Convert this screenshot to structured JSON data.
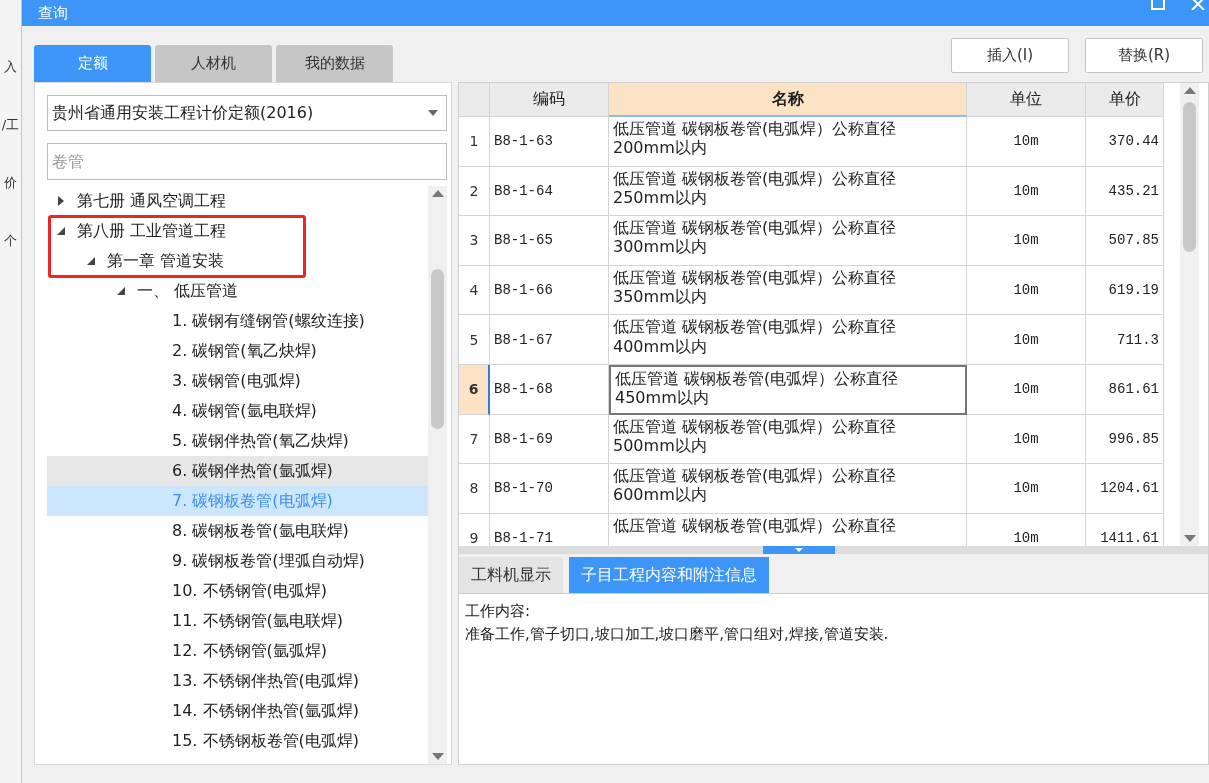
{
  "background_app": {
    "fragments": [
      "入",
      "/工",
      "价",
      "个"
    ]
  },
  "window": {
    "title": "查询"
  },
  "tabs": [
    {
      "label": "定额",
      "selected": true
    },
    {
      "label": "人材机",
      "selected": false
    },
    {
      "label": "我的数据",
      "selected": false
    }
  ],
  "actions": [
    "插入(I)",
    "替换(R)"
  ],
  "quota_book": {
    "value": "贵州省通用安装工程计价定额(2016)"
  },
  "search": {
    "placeholder": "卷管"
  },
  "tree": [
    {
      "label": "第七册 通风空调工程",
      "expanded": false,
      "selected": false
    },
    {
      "label": "第八册 工业管道工程",
      "expanded": true,
      "selected": false,
      "children": [
        {
          "label": "第一章 管道安装",
          "expanded": true,
          "selected": false,
          "children": [
            {
              "label": "一、  低压管道",
              "expanded": true,
              "selected": false,
              "children": [
                {
                  "label": "1. 碳钢有缝钢管(螺纹连接)",
                  "selected": false,
                  "hovered": false
                },
                {
                  "label": "2. 碳钢管(氧乙炔焊)",
                  "selected": false,
                  "hovered": false
                },
                {
                  "label": "3. 碳钢管(电弧焊)",
                  "selected": false,
                  "hovered": false
                },
                {
                  "label": "4. 碳钢管(氩电联焊)",
                  "selected": false,
                  "hovered": false
                },
                {
                  "label": "5. 碳钢伴热管(氧乙炔焊)",
                  "selected": false,
                  "hovered": false
                },
                {
                  "label": "6. 碳钢伴热管(氩弧焊)",
                  "selected": false,
                  "hovered": true
                },
                {
                  "label": "7. 碳钢板卷管(电弧焊)",
                  "selected": true,
                  "hovered": false
                },
                {
                  "label": "8. 碳钢板卷管(氩电联焊)",
                  "selected": false,
                  "hovered": false
                },
                {
                  "label": "9. 碳钢板卷管(埋弧自动焊)",
                  "selected": false,
                  "hovered": false
                },
                {
                  "label": "10. 不锈钢管(电弧焊)",
                  "selected": false,
                  "hovered": false
                },
                {
                  "label": "11. 不锈钢管(氩电联焊)",
                  "selected": false,
                  "hovered": false
                },
                {
                  "label": "12. 不锈钢管(氩弧焊)",
                  "selected": false,
                  "hovered": false
                },
                {
                  "label": "13. 不锈钢伴热管(电弧焊)",
                  "selected": false,
                  "hovered": false
                },
                {
                  "label": "14. 不锈钢伴热管(氩弧焊)",
                  "selected": false,
                  "hovered": false
                },
                {
                  "label": "15. 不锈钢板卷管(电弧焊)",
                  "selected": false,
                  "hovered": false
                }
              ]
            }
          ]
        }
      ]
    }
  ],
  "table": {
    "columns": [
      {
        "label": "编码",
        "selected": false
      },
      {
        "label": "名称",
        "selected": true
      },
      {
        "label": "单位",
        "selected": false
      },
      {
        "label": "单价",
        "selected": false
      }
    ],
    "rows": [
      {
        "index": "1",
        "code": "B8-1-63",
        "name": "低压管道 碳钢板卷管(电弧焊）公称直径200mm以内",
        "unit": "10m",
        "price": "370.44",
        "selected": false
      },
      {
        "index": "2",
        "code": "B8-1-64",
        "name": "低压管道 碳钢板卷管(电弧焊）公称直径250mm以内",
        "unit": "10m",
        "price": "435.21",
        "selected": false
      },
      {
        "index": "3",
        "code": "B8-1-65",
        "name": "低压管道 碳钢板卷管(电弧焊）公称直径300mm以内",
        "unit": "10m",
        "price": "507.85",
        "selected": false
      },
      {
        "index": "4",
        "code": "B8-1-66",
        "name": "低压管道 碳钢板卷管(电弧焊）公称直径350mm以内",
        "unit": "10m",
        "price": "619.19",
        "selected": false
      },
      {
        "index": "5",
        "code": "B8-1-67",
        "name": "低压管道 碳钢板卷管(电弧焊）公称直径400mm以内",
        "unit": "10m",
        "price": "711.3",
        "selected": false
      },
      {
        "index": "6",
        "code": "B8-1-68",
        "name": "低压管道 碳钢板卷管(电弧焊）公称直径450mm以内",
        "unit": "10m",
        "price": "861.61",
        "selected": true
      },
      {
        "index": "7",
        "code": "B8-1-69",
        "name": "低压管道 碳钢板卷管(电弧焊）公称直径500mm以内",
        "unit": "10m",
        "price": "996.85",
        "selected": false
      },
      {
        "index": "8",
        "code": "B8-1-70",
        "name": "低压管道 碳钢板卷管(电弧焊）公称直径600mm以内",
        "unit": "10m",
        "price": "1204.61",
        "selected": false
      },
      {
        "index": "9",
        "code": "B8-1-71",
        "name": "低压管道 碳钢板卷管(电弧焊）公称直径",
        "unit": "10m",
        "price": "1411.61",
        "selected": false
      }
    ]
  },
  "detail_tabs": [
    {
      "label": "工料机显示",
      "selected": false
    },
    {
      "label": "子目工程内容和附注信息",
      "selected": true
    }
  ],
  "detail": {
    "heading": "工作内容:",
    "text": "准备工作,管子切口,坡口加工,坡口磨平,管口组对,焊接,管道安装."
  }
}
